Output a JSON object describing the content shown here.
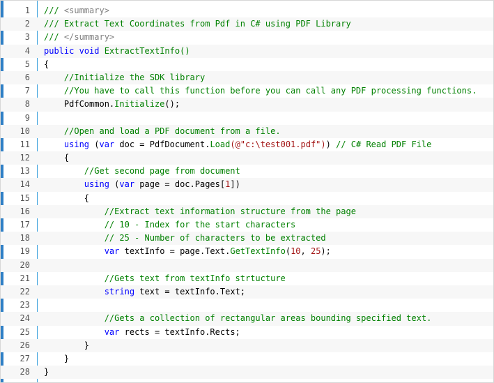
{
  "colors": {
    "accent_bar": "#2f7fc6",
    "gutter_border": "#3aa0dc",
    "comment": "#008000",
    "keyword": "#0000ff",
    "string": "#a31515",
    "alt_row": "#f7f7f7"
  },
  "lines": [
    {
      "n": "1",
      "tokens": [
        {
          "t": "/// ",
          "c": "comment"
        },
        {
          "t": "<summary>",
          "c": "doc"
        }
      ]
    },
    {
      "n": "2",
      "tokens": [
        {
          "t": "/// Extract Text Coordinates from Pdf in C# using PDF Library",
          "c": "comment"
        }
      ]
    },
    {
      "n": "3",
      "tokens": [
        {
          "t": "/// ",
          "c": "comment"
        },
        {
          "t": "</summary>",
          "c": "doc"
        }
      ]
    },
    {
      "n": "4",
      "tokens": [
        {
          "t": "public",
          "c": "keyword"
        },
        {
          "t": " ",
          "c": "plain"
        },
        {
          "t": "void",
          "c": "keyword"
        },
        {
          "t": " ExtractTextInfo()",
          "c": "method"
        }
      ]
    },
    {
      "n": "5",
      "tokens": [
        {
          "t": "{",
          "c": "plain"
        }
      ]
    },
    {
      "n": "6",
      "tokens": [
        {
          "t": "    //Initialize the SDK library",
          "c": "comment"
        }
      ]
    },
    {
      "n": "7",
      "tokens": [
        {
          "t": "    //You have to call this function before you can call any PDF processing functions.",
          "c": "comment"
        }
      ]
    },
    {
      "n": "8",
      "tokens": [
        {
          "t": "    PdfCommon.",
          "c": "plain"
        },
        {
          "t": "Initialize",
          "c": "method"
        },
        {
          "t": "();",
          "c": "plain"
        }
      ]
    },
    {
      "n": "9",
      "tokens": []
    },
    {
      "n": "10",
      "tokens": [
        {
          "t": "    //Open and load a PDF document from a file.",
          "c": "comment"
        }
      ]
    },
    {
      "n": "11",
      "tokens": [
        {
          "t": "    ",
          "c": "plain"
        },
        {
          "t": "using",
          "c": "keyword"
        },
        {
          "t": " (",
          "c": "plain"
        },
        {
          "t": "var",
          "c": "keyword"
        },
        {
          "t": " doc = PdfDocument.",
          "c": "plain"
        },
        {
          "t": "Load",
          "c": "method"
        },
        {
          "t": "(@\"c:\\test001.pdf\")",
          "c": "string"
        },
        {
          "t": ") ",
          "c": "plain"
        },
        {
          "t": "// C# Read PDF File",
          "c": "comment"
        }
      ]
    },
    {
      "n": "12",
      "tokens": [
        {
          "t": "    {",
          "c": "plain"
        }
      ]
    },
    {
      "n": "13",
      "tokens": [
        {
          "t": "        //Get second page from document",
          "c": "comment"
        }
      ]
    },
    {
      "n": "14",
      "tokens": [
        {
          "t": "        ",
          "c": "plain"
        },
        {
          "t": "using",
          "c": "keyword"
        },
        {
          "t": " (",
          "c": "plain"
        },
        {
          "t": "var",
          "c": "keyword"
        },
        {
          "t": " page = doc.Pages[",
          "c": "plain"
        },
        {
          "t": "1",
          "c": "number"
        },
        {
          "t": "])",
          "c": "plain"
        }
      ]
    },
    {
      "n": "15",
      "tokens": [
        {
          "t": "        {",
          "c": "plain"
        }
      ]
    },
    {
      "n": "16",
      "tokens": [
        {
          "t": "            //Extract text information structure from the page",
          "c": "comment"
        }
      ]
    },
    {
      "n": "17",
      "tokens": [
        {
          "t": "            // 10 - Index for the start characters",
          "c": "comment"
        }
      ]
    },
    {
      "n": "18",
      "tokens": [
        {
          "t": "            // 25 - Number of characters to be extracted",
          "c": "comment"
        }
      ]
    },
    {
      "n": "19",
      "tokens": [
        {
          "t": "            ",
          "c": "plain"
        },
        {
          "t": "var",
          "c": "keyword"
        },
        {
          "t": " textInfo = page.Text.",
          "c": "plain"
        },
        {
          "t": "GetTextInfo",
          "c": "method"
        },
        {
          "t": "(",
          "c": "plain"
        },
        {
          "t": "10",
          "c": "number"
        },
        {
          "t": ", ",
          "c": "plain"
        },
        {
          "t": "25",
          "c": "number"
        },
        {
          "t": ");",
          "c": "plain"
        }
      ]
    },
    {
      "n": "20",
      "tokens": []
    },
    {
      "n": "21",
      "tokens": [
        {
          "t": "            //Gets text from textInfo strtucture",
          "c": "comment"
        }
      ]
    },
    {
      "n": "22",
      "tokens": [
        {
          "t": "            ",
          "c": "plain"
        },
        {
          "t": "string",
          "c": "keyword"
        },
        {
          "t": " text = textInfo.Text;",
          "c": "plain"
        }
      ]
    },
    {
      "n": "23",
      "tokens": []
    },
    {
      "n": "24",
      "tokens": [
        {
          "t": "            //Gets a collection of rectangular areas bounding specified text.",
          "c": "comment"
        }
      ]
    },
    {
      "n": "25",
      "tokens": [
        {
          "t": "            ",
          "c": "plain"
        },
        {
          "t": "var",
          "c": "keyword"
        },
        {
          "t": " rects = textInfo.Rects;",
          "c": "plain"
        }
      ]
    },
    {
      "n": "26",
      "tokens": [
        {
          "t": "        }",
          "c": "plain"
        }
      ]
    },
    {
      "n": "27",
      "tokens": [
        {
          "t": "    }",
          "c": "plain"
        }
      ]
    },
    {
      "n": "28",
      "tokens": [
        {
          "t": "}",
          "c": "plain"
        }
      ]
    }
  ]
}
